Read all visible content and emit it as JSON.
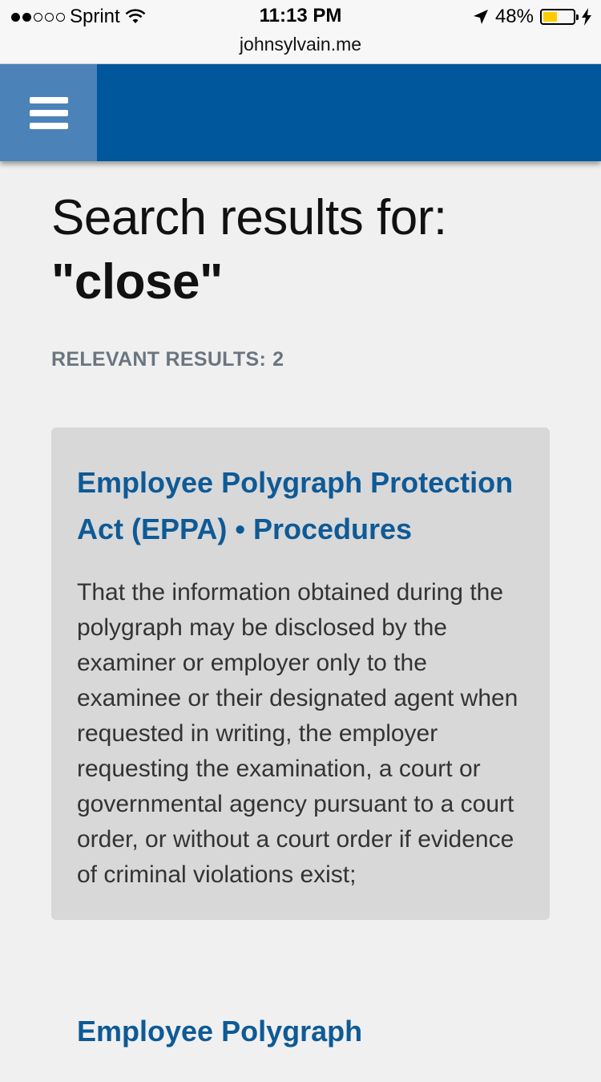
{
  "status_bar": {
    "carrier": "Sprint",
    "time": "11:13 PM",
    "battery_percent": "48%",
    "battery_level": 0.48,
    "battery_color": "#ffcc00",
    "signal_bars_filled": 2,
    "signal_bars_total": 5,
    "icons": [
      "wifi-icon",
      "location-arrow-icon",
      "charging-bolt-icon"
    ]
  },
  "browser": {
    "url": "johnsylvain.me"
  },
  "header": {
    "background_color": "#00579b",
    "menu_button_color": "#4b82b8",
    "menu_icon": "hamburger-menu-icon"
  },
  "search": {
    "heading_prefix": "Search results for:",
    "query_display": "\"close\"",
    "count_label": "RELEVANT RESULTS:",
    "count": "2"
  },
  "results": [
    {
      "title": "Employee Polygraph Protection Act (EPPA) • Procedures",
      "excerpt": "That the information obtained during the polygraph may be disclosed by the examiner or employer only to the examinee or their designated agent when requested in writing, the employer requesting the examination, a court or governmental agency pursuant to a court order, or without a court order if evidence of criminal violations exist;"
    },
    {
      "title": "Employee Polygraph"
    }
  ],
  "colors": {
    "page_background": "#f0f0f0",
    "card_background": "#d8d8d8",
    "link": "#0e5a96",
    "count_text": "#6b7580"
  }
}
